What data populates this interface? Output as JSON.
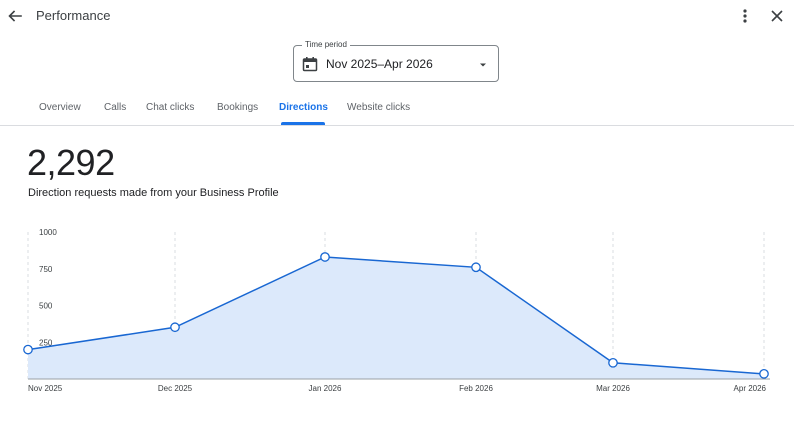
{
  "header": {
    "title": "Performance"
  },
  "icons": {
    "back": "arrow-back-icon",
    "more": "more-vert-icon",
    "close": "close-icon",
    "calendar": "calendar-icon",
    "caret": "caret-down-icon"
  },
  "period": {
    "label": "Time period",
    "value": "Nov 2025–Apr 2026"
  },
  "tabs": [
    {
      "label": "Overview",
      "active": false
    },
    {
      "label": "Calls",
      "active": false
    },
    {
      "label": "Chat clicks",
      "active": false
    },
    {
      "label": "Bookings",
      "active": false
    },
    {
      "label": "Directions",
      "active": true
    },
    {
      "label": "Website clicks",
      "active": false
    }
  ],
  "metric": {
    "value": "2,292",
    "description": "Direction requests made from your Business Profile"
  },
  "colors": {
    "accent": "#1a73e8",
    "line": "#1967d2",
    "fill": "#dce9fb",
    "grid": "#dadce0",
    "text": "#202124"
  },
  "chart_data": {
    "type": "area",
    "categories": [
      "Nov 2025",
      "Dec 2025",
      "Jan 2026",
      "Feb 2026",
      "Mar 2026",
      "Apr 2026"
    ],
    "values": [
      200,
      352,
      830,
      760,
      110,
      35
    ],
    "yticks": [
      "1000",
      "750",
      "500",
      "250"
    ],
    "ylim": [
      0,
      1000
    ],
    "grid": true
  }
}
